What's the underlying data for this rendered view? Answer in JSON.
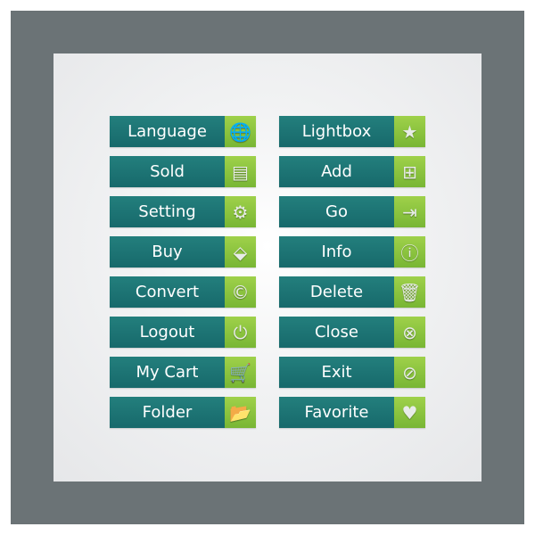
{
  "colors": {
    "frame": "#6b7376",
    "label_bg": "#1f7a78",
    "icon_bg": "#8cc63f",
    "text": "#ffffff"
  },
  "left_column": [
    {
      "label": "Language",
      "icon": "globe-icon",
      "glyph": "🌐"
    },
    {
      "label": "Sold",
      "icon": "basket-icon",
      "glyph": "▤"
    },
    {
      "label": "Setting",
      "icon": "gear-icon",
      "glyph": "⚙"
    },
    {
      "label": "Buy",
      "icon": "price-tag-icon",
      "glyph": "⬙"
    },
    {
      "label": "Convert",
      "icon": "copyright-icon",
      "glyph": "©"
    },
    {
      "label": "Logout",
      "icon": "power-icon",
      "glyph": "⏻"
    },
    {
      "label": "My Cart",
      "icon": "cart-icon",
      "glyph": "🛒"
    },
    {
      "label": "Folder",
      "icon": "folder-icon",
      "glyph": "📂"
    }
  ],
  "right_column": [
    {
      "label": "Lightbox",
      "icon": "star-icon",
      "glyph": "★"
    },
    {
      "label": "Add",
      "icon": "add-icon",
      "glyph": "⊞"
    },
    {
      "label": "Go",
      "icon": "enter-icon",
      "glyph": "⇥"
    },
    {
      "label": "Info",
      "icon": "info-icon",
      "glyph": "ⓘ"
    },
    {
      "label": "Delete",
      "icon": "trash-icon",
      "glyph": "🗑"
    },
    {
      "label": "Close",
      "icon": "close-circle-icon",
      "glyph": "⊗"
    },
    {
      "label": "Exit",
      "icon": "no-entry-icon",
      "glyph": "⊘"
    },
    {
      "label": "Favorite",
      "icon": "heart-icon",
      "glyph": "♥"
    }
  ]
}
